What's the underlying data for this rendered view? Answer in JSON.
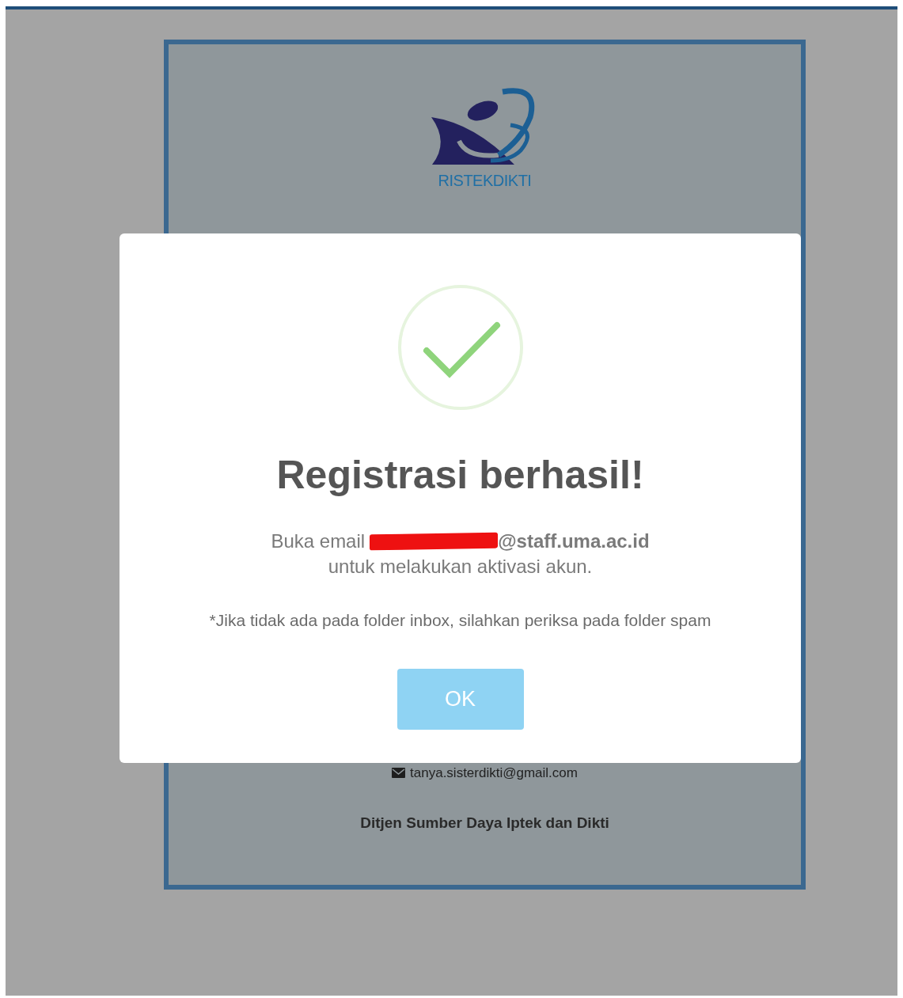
{
  "logo": {
    "text": "RISTEKDIKTI"
  },
  "contact_email": "tanya.sisterdikti@gmail.com",
  "organization": "Ditjen Sumber Daya Iptek dan Dikti",
  "dialog": {
    "title": "Registrasi berhasil!",
    "message_prefix": "Buka email",
    "email_redacted": true,
    "email_domain": "@staff.uma.ac.id",
    "message_line2": "untuk melakukan aktivasi akun.",
    "note": "*Jika tidak ada pada folder inbox, silahkan periksa pada folder spam",
    "button": "OK"
  }
}
